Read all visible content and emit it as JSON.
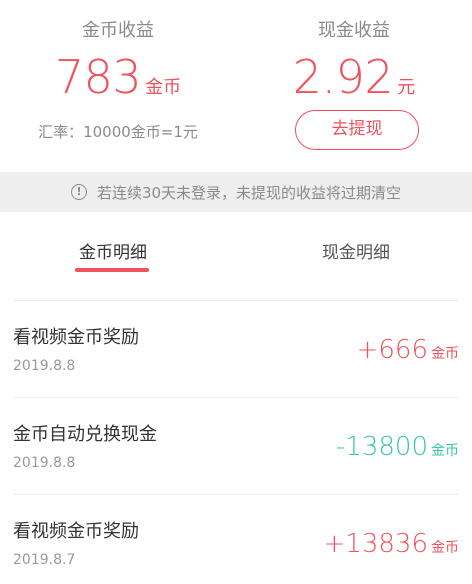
{
  "summary": {
    "coins": {
      "title": "金币收益",
      "amount": "783",
      "unit": "金币",
      "rate": "汇率：10000金币=1元"
    },
    "cash": {
      "title": "现金收益",
      "amount": "2.92",
      "unit": "元",
      "withdraw_label": "去提现"
    }
  },
  "notice": {
    "icon": "info-icon",
    "text": "若连续30天未登录，未提现的收益将过期清空"
  },
  "tabs": [
    {
      "label": "金币明细",
      "active": true
    },
    {
      "label": "现金明细",
      "active": false
    }
  ],
  "records": [
    {
      "title": "看视频金币奖励",
      "date": "2019.8.8",
      "amount": "+666",
      "unit": "金币",
      "type": "income"
    },
    {
      "title": "金币自动兑换现金",
      "date": "2019.8.8",
      "amount": "-13800",
      "unit": "金币",
      "type": "expense"
    },
    {
      "title": "看视频金币奖励",
      "date": "2019.8.7",
      "amount": "+13836",
      "unit": "金币",
      "type": "income"
    }
  ],
  "colors": {
    "accent": "#f0515a",
    "expense": "#35c9a0",
    "notice_bg": "#eeeeee"
  }
}
